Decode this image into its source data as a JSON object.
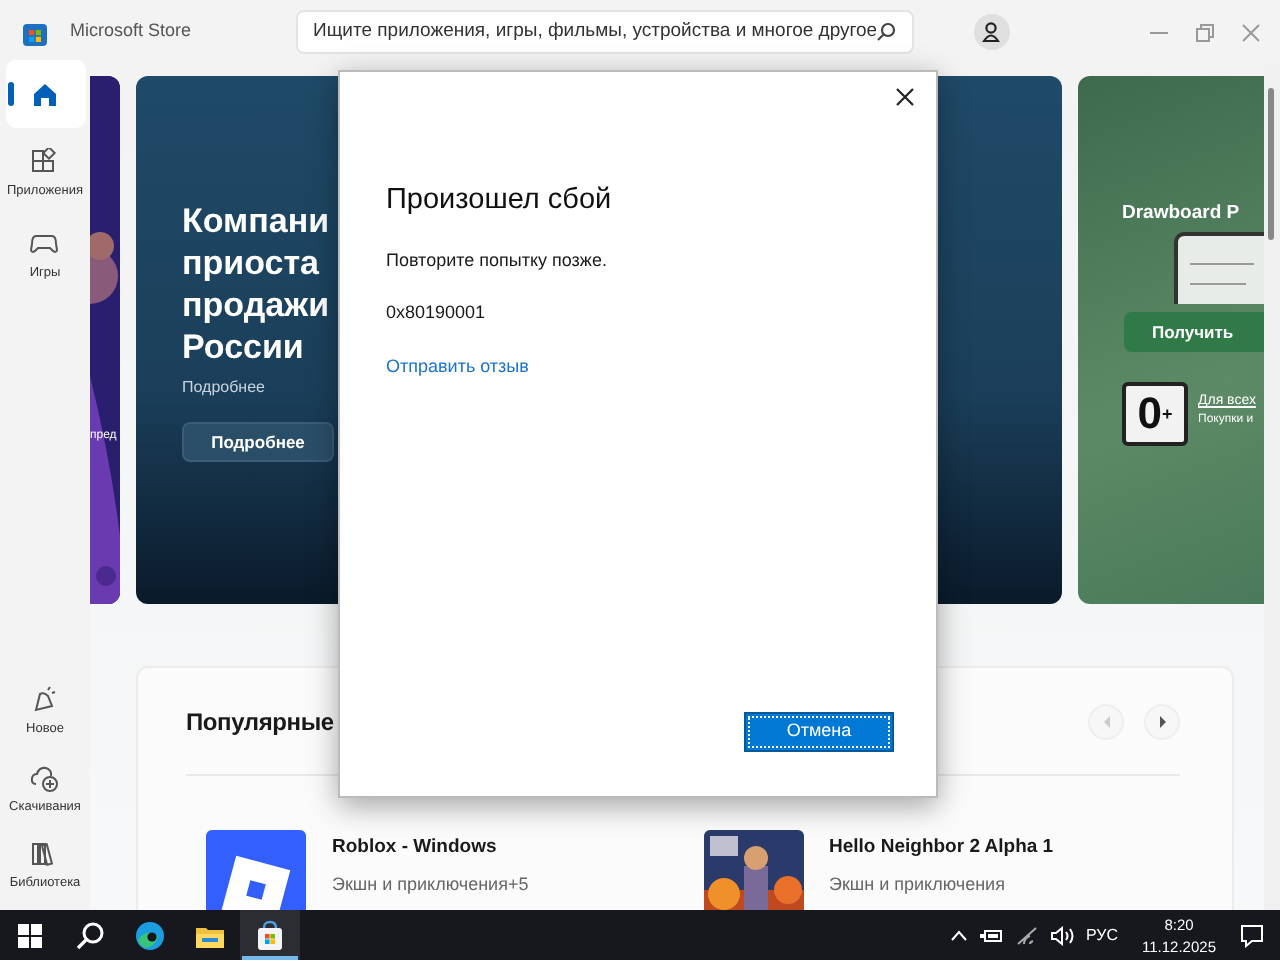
{
  "window": {
    "title": "Microsoft Store"
  },
  "search": {
    "placeholder": "Ищите приложения, игры, фильмы, устройства и многое другое"
  },
  "sidebar": {
    "top": [
      {
        "kind": "home",
        "selected": true
      },
      {
        "kind": "apps",
        "label": "Приложения",
        "selected": false
      },
      {
        "kind": "games",
        "label": "Игры",
        "selected": false
      }
    ],
    "bottom": [
      {
        "kind": "new",
        "label": "Новое",
        "selected": false
      },
      {
        "kind": "downloads",
        "label": "Скачивания",
        "selected": false
      },
      {
        "kind": "library",
        "label": "Библиотека",
        "selected": false
      }
    ]
  },
  "hero": {
    "left_card": {
      "text": "пред"
    },
    "main_card": {
      "title_lines": [
        "Компани",
        "приоста",
        "продажи",
        "России"
      ],
      "subtitle": "Подробнее",
      "button": "Подробнее"
    },
    "side_card": {
      "title": "Drawboard P",
      "button": "Получить",
      "rating": "0$^{+}$",
      "rating_label": "Для всех",
      "rating_note": "Покупки и"
    }
  },
  "popular": {
    "title": "Популярные",
    "carousel": [
      {
        "kind": "prev",
        "disabled": true
      },
      {
        "kind": "next",
        "disabled": false
      }
    ],
    "apps": [
      {
        "kind": "roblox",
        "name": "Roblox - Windows",
        "category": "Экшн и приключения+5"
      },
      {
        "kind": "picture",
        "name": "Hello Neighbor 2 Alpha 1",
        "category": "Экшн и приключения"
      }
    ]
  },
  "dialog": {
    "title": "Произошел сбой",
    "message": "Повторите попытку позже.",
    "code": "0x80190001",
    "link": "Отправить отзыв",
    "button": "Отмена"
  },
  "taskbar": {
    "apps": [
      {
        "kind": "start",
        "selected": false
      },
      {
        "kind": "search",
        "selected": false
      },
      {
        "kind": "edge",
        "selected": false
      },
      {
        "kind": "explorer",
        "selected": false
      },
      {
        "kind": "store",
        "selected": true
      }
    ],
    "language": "РУС",
    "time": "8:20",
    "date": "11.12.2025"
  }
}
